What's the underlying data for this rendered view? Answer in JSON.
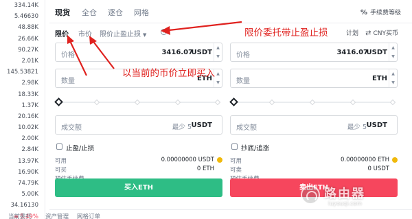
{
  "orderbook": {
    "rows": [
      "334.14K",
      "5.46630",
      "48.88K",
      "26.66K",
      "90.27K",
      "2.01K",
      "145.53821",
      "2.98K",
      "18.33K",
      "1.37K",
      "20.16K",
      "10.02K",
      "2.00K",
      "2.84K",
      "13.97K",
      "16.90K",
      "74.79K",
      "5.00K",
      "34.16130"
    ],
    "change": "5.49%"
  },
  "tabs": {
    "items": [
      "现货",
      "全仓",
      "逐仓",
      "网格"
    ],
    "fee_label": "手续费等级",
    "fee_icon": "%"
  },
  "order_types": {
    "limit": "限价",
    "market": "市价",
    "tpsl": "限价止盈止损",
    "plan": "计划",
    "cny": "CNY买币"
  },
  "buy": {
    "price_label": "价格",
    "price_value": "3416.07",
    "price_unit": "USDT",
    "qty_label": "数量",
    "qty_unit": "ETH",
    "total_label": "成交额",
    "total_hint": "最少 5",
    "total_unit": "USDT",
    "check_label": "止盈/止损",
    "avail_label": "可用",
    "avail_value": "0.00000000 USDT",
    "can_label": "可买",
    "can_value": "0 ETH",
    "fee_label": "预估手续费",
    "button": "买入ETH"
  },
  "sell": {
    "price_label": "价格",
    "price_value": "3416.07",
    "price_unit": "USDT",
    "qty_label": "数量",
    "qty_unit": "ETH",
    "total_label": "成交额",
    "total_hint": "最少 5",
    "total_unit": "USDT",
    "check_label": "抄底/追涨",
    "avail_label": "可用",
    "avail_value": "0.00000000 ETH",
    "can_label": "可卖",
    "can_value": "0 USDT",
    "fee_label": "预估手续费",
    "button": "卖出ETH"
  },
  "bottom": {
    "tabs": [
      "当前委托",
      "资产管理",
      "网格订单"
    ]
  },
  "annotations": {
    "top": "限价委托带止盈止损",
    "middle": "以当前的币价立即买入"
  },
  "watermark": {
    "name": "路由器",
    "url": "luyouqi.com"
  },
  "colors": {
    "buy": "#2ebd85",
    "sell": "#f6465d",
    "annotation": "#e0221f"
  }
}
